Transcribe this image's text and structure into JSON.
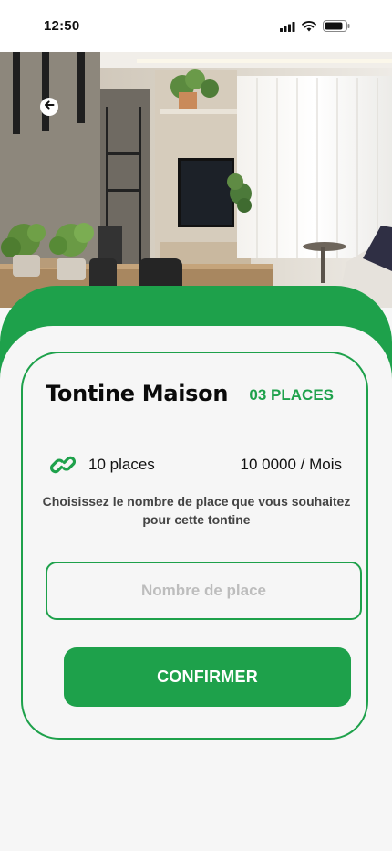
{
  "status_bar": {
    "time": "12:50",
    "icons": [
      "signal-icon",
      "wifi-icon",
      "battery-icon"
    ]
  },
  "hero": {
    "image": "living-room-photo",
    "back_icon": "arrow-left-icon"
  },
  "tontine": {
    "title": "Tontine Maison",
    "places_badge": "03 PLACES",
    "places_count": "10 places",
    "price": "10 0000 / Mois",
    "link_icon": "link-icon",
    "instruction": "Choisissez le nombre de place que vous souhaitez pour cette tontine"
  },
  "form": {
    "input_placeholder": "Nombre de place",
    "input_value": "",
    "confirm_label": "CONFIRMER"
  },
  "colors": {
    "accent": "#1ea14b",
    "background": "#f6f6f6"
  }
}
